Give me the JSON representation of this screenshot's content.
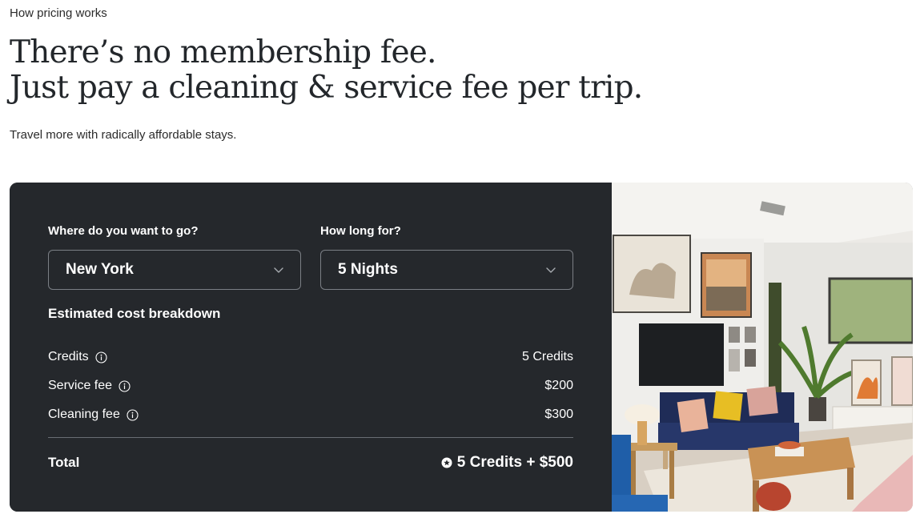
{
  "header": {
    "eyebrow": "How pricing works",
    "headline_line1": "There’s no membership fee.",
    "headline_line2": "Just pay a cleaning & service fee per trip.",
    "subtitle": "Travel more with radically affordable stays."
  },
  "calculator": {
    "destination": {
      "label": "Where do you want to go?",
      "value": "New York"
    },
    "duration": {
      "label": "How long for?",
      "value": "5 Nights"
    },
    "breakdown_title": "Estimated cost breakdown",
    "rows": [
      {
        "label": "Credits",
        "value": "5 Credits"
      },
      {
        "label": "Service fee",
        "value": "$200"
      },
      {
        "label": "Cleaning fee",
        "value": "$300"
      }
    ],
    "total": {
      "label": "Total",
      "value": "5 Credits + $500"
    }
  },
  "colors": {
    "panel": "#25282c",
    "text_dark": "#23272b",
    "border": "#7b7f85"
  },
  "icons": {
    "select_arrow": "chevron-down-icon",
    "row_info": "info-icon",
    "credit": "credit-icon"
  }
}
